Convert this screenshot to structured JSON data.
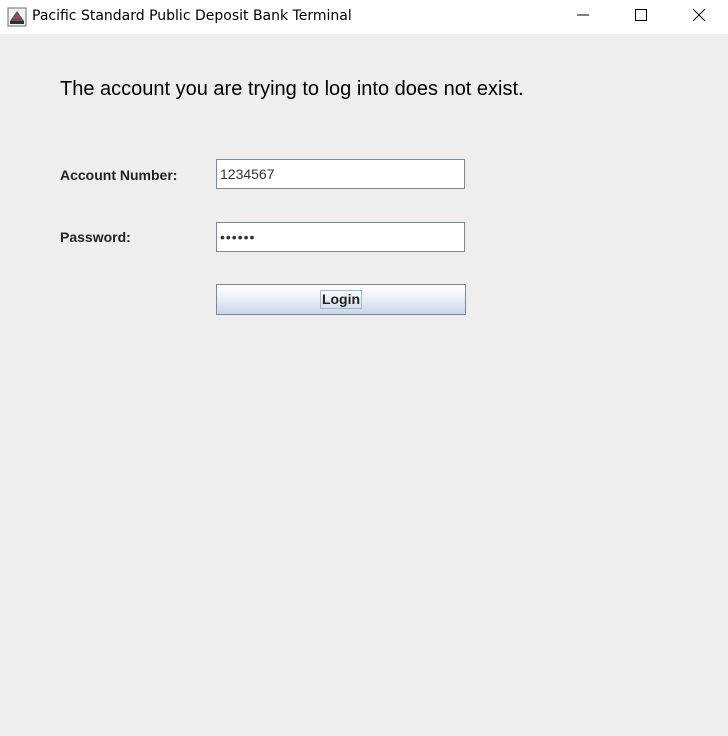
{
  "window": {
    "title": "Pacific Standard Public Deposit Bank Terminal",
    "icon": "java-app-icon"
  },
  "titlebar_buttons": {
    "minimize_icon": "minimize-icon",
    "maximize_icon": "maximize-icon",
    "close_icon": "close-icon"
  },
  "message": "The account you are trying to log into does not exist.",
  "form": {
    "account_label": "Account Number:",
    "account_value": "1234567",
    "password_label": "Password:",
    "password_value": "••••••",
    "login_label": "Login"
  },
  "colors": {
    "background": "#eeeeee",
    "button_gradient_bottom": "#c7d7ea",
    "field_border": "#7a8a99"
  }
}
